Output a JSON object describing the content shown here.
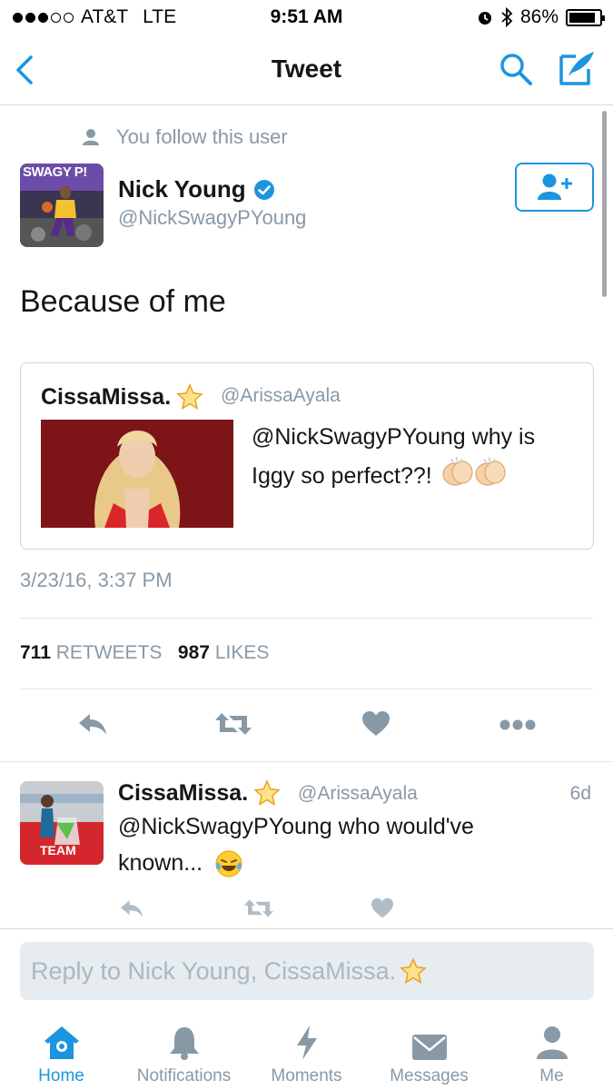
{
  "status_bar": {
    "carrier": "AT&T",
    "network": "LTE",
    "time": "9:51 AM",
    "battery": "86%",
    "battery_level": 0.86
  },
  "nav": {
    "title": "Tweet"
  },
  "tweet": {
    "follow_note": "You follow this user",
    "author_name": "Nick Young",
    "author_handle": "@NickSwagyPYoung",
    "avatar_text": "SWAGY P!",
    "text": "Because of me",
    "timestamp": "3/23/16, 3:37 PM",
    "retweets_count": "711",
    "retweets_label": "RETWEETS",
    "likes_count": "987",
    "likes_label": "LIKES"
  },
  "quote": {
    "name": "CissaMissa.",
    "handle": "@ArissaAyala",
    "text": "@NickSwagyPYoung why is Iggy so perfect??!"
  },
  "reply": {
    "name": "CissaMissa.",
    "handle": "@ArissaAyala",
    "time": "6d",
    "text_line1": "@NickSwagyPYoung  who would've",
    "text_line2": "known...",
    "avatar_text": "TEAM"
  },
  "reply_box": {
    "placeholder": "Reply to Nick Young, CissaMissa."
  },
  "tabs": [
    {
      "label": "Home",
      "icon": "home-icon"
    },
    {
      "label": "Notifications",
      "icon": "bell-icon"
    },
    {
      "label": "Moments",
      "icon": "lightning-icon"
    },
    {
      "label": "Messages",
      "icon": "envelope-icon"
    },
    {
      "label": "Me",
      "icon": "person-icon"
    }
  ],
  "colors": {
    "accent": "#1b95e0",
    "muted": "#8899a6",
    "text": "#14171a"
  }
}
